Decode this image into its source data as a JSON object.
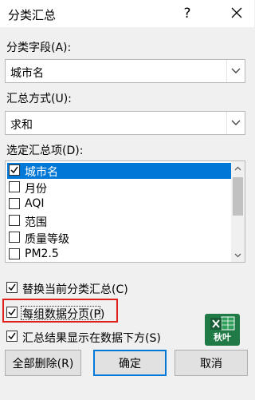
{
  "dialog": {
    "title": "分类汇总",
    "help": "?"
  },
  "field": {
    "label": "分类字段(A):",
    "value": "城市名"
  },
  "method": {
    "label": "汇总方式(U):",
    "value": "求和"
  },
  "items": {
    "label": "选定汇总项(D):",
    "list": [
      {
        "label": "城市名",
        "checked": true,
        "selected": true
      },
      {
        "label": "月份",
        "checked": false,
        "selected": false
      },
      {
        "label": "AQI",
        "checked": false,
        "selected": false
      },
      {
        "label": "范围",
        "checked": false,
        "selected": false
      },
      {
        "label": "质量等级",
        "checked": false,
        "selected": false
      },
      {
        "label": "PM2.5",
        "checked": false,
        "selected": false
      }
    ]
  },
  "options": {
    "replace_current": {
      "label": "替换当前分类汇总(C)",
      "checked": true
    },
    "page_break": {
      "label": "每组数据分页(P)",
      "checked": true
    },
    "summary_below": {
      "label": "汇总结果显示在数据下方(S)",
      "checked": true
    }
  },
  "buttons": {
    "remove_all": "全部删除(R)",
    "ok": "确定",
    "cancel": "取消"
  },
  "logo": {
    "name": "excel-icon",
    "brand": "秋叶",
    "color": "#1f7a45"
  },
  "colors": {
    "accent": "#0078d7",
    "highlight": "#e0201b"
  }
}
